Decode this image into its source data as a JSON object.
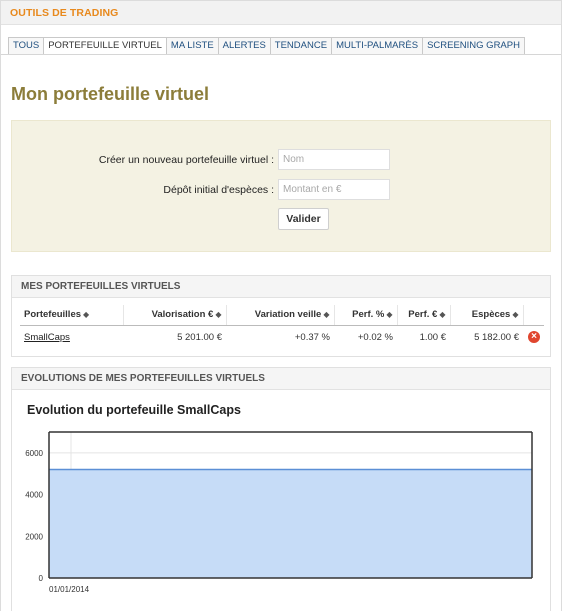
{
  "header": {
    "title": "OUTILS DE TRADING"
  },
  "tabs": [
    {
      "label": "TOUS",
      "active": false
    },
    {
      "label": "PORTEFEUILLE VIRTUEL",
      "active": true
    },
    {
      "label": "MA LISTE",
      "active": false
    },
    {
      "label": "ALERTES",
      "active": false
    },
    {
      "label": "TENDANCE",
      "active": false
    },
    {
      "label": "MULTI-PALMARÈS",
      "active": false
    },
    {
      "label": "SCREENING GRAPH",
      "active": false
    }
  ],
  "page_title": "Mon portefeuille virtuel",
  "form": {
    "name_label": "Créer un nouveau portefeuille virtuel :",
    "name_placeholder": "Nom",
    "deposit_label": "Dépôt initial d'espèces :",
    "deposit_placeholder": "Montant en €",
    "submit_label": "Valider"
  },
  "portfolios": {
    "title": "MES PORTEFEUILLES VIRTUELS",
    "sort_icon": "sort-arrows-icon",
    "columns": [
      "Portefeuilles",
      "Valorisation €",
      "Variation veille",
      "Perf. %",
      "Perf. €",
      "Espèces"
    ],
    "rows": [
      {
        "name": "SmallCaps",
        "valorisation": "5 201.00 €",
        "variation": "+0.37 %",
        "perf_pct": "+0.02 %",
        "perf_eur": "1.00 €",
        "especes": "5 182.00 €",
        "delete_icon": "delete-icon"
      }
    ]
  },
  "evolution": {
    "title": "EVOLUTIONS DE MES PORTEFEUILLES VIRTUELS",
    "chart_title": "Evolution du portefeuille SmallCaps",
    "colors": {
      "fill": "#c6dcf7",
      "line": "#5b8fd6",
      "axis": "#333333"
    }
  },
  "chart_data": {
    "type": "area",
    "title": "Evolution du portefeuille SmallCaps",
    "x": [
      "01/01/2014"
    ],
    "series": [
      {
        "values": [
          5201
        ]
      }
    ],
    "y_ticks": [
      "0",
      "2000",
      "4000",
      "6000"
    ],
    "ylim": [
      0,
      7000
    ],
    "grid": true
  }
}
